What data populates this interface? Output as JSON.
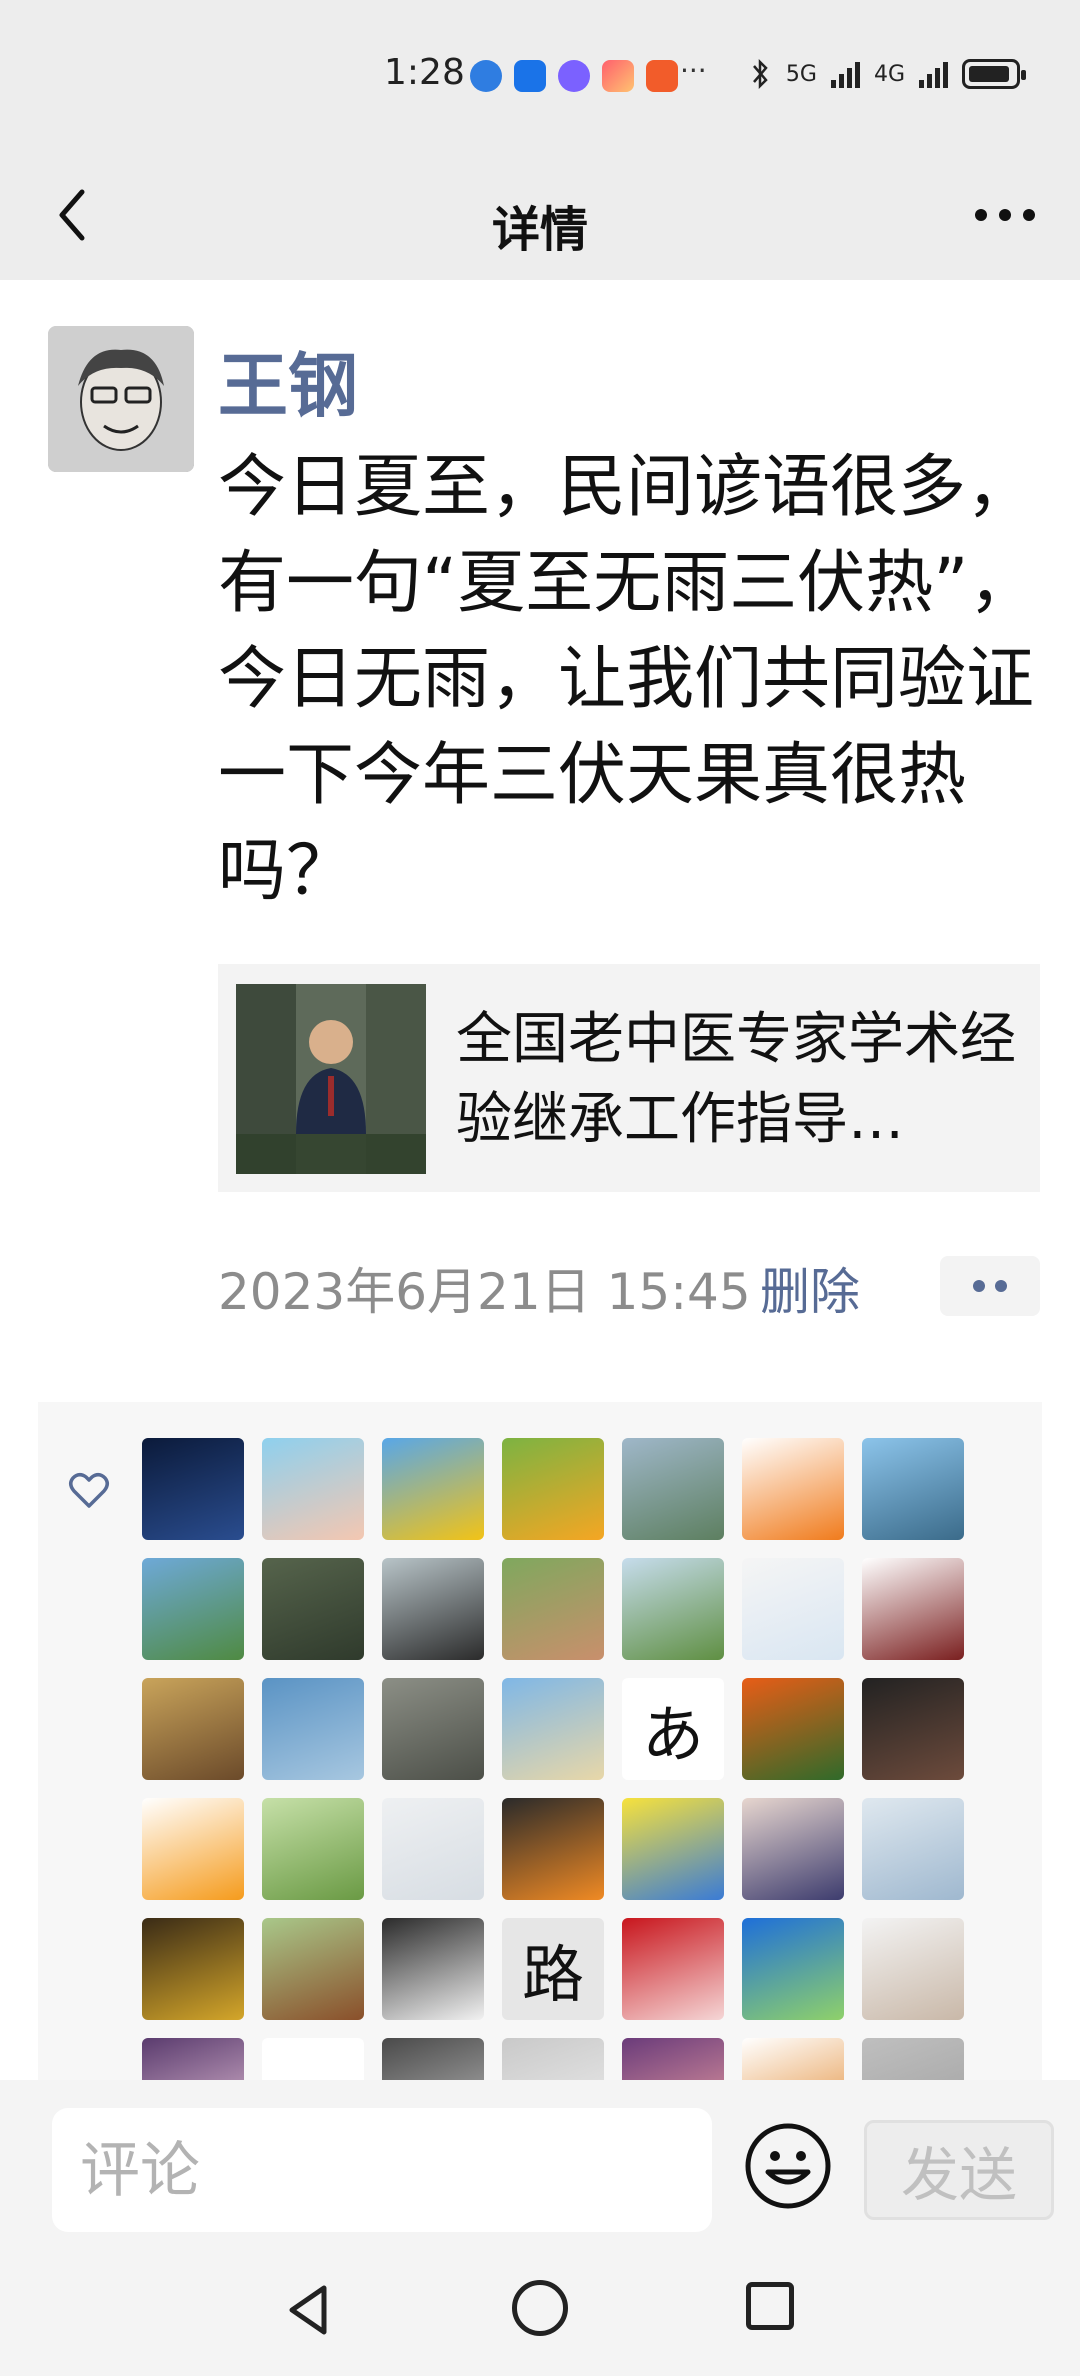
{
  "status_bar": {
    "time": "1:28",
    "network_labels": [
      "5G",
      "4G"
    ]
  },
  "nav": {
    "title": "详情"
  },
  "post": {
    "author": "王钢",
    "text": "今日夏至，民间谚语很多，有一句“夏至无雨三伏热”，今日无雨，让我们共同验证一下今年三伏天果真很热吗？",
    "link_card": {
      "title": "全国老中医专家学术经验继承工作指导…"
    },
    "timestamp": "2023年6月21日 15:45",
    "delete_label": "删除"
  },
  "likes": {
    "avatars": [
      {
        "icon": "planets-avatar",
        "colors": [
          "#0b1a3a",
          "#2a4d8f"
        ]
      },
      {
        "icon": "cartoon-girl-avatar",
        "colors": [
          "#8ed0ee",
          "#f4c7b1"
        ]
      },
      {
        "icon": "sunflower-avatar",
        "colors": [
          "#58a7e8",
          "#f2c316"
        ]
      },
      {
        "icon": "apricots-avatar",
        "colors": [
          "#7cb342",
          "#f5a623"
        ]
      },
      {
        "icon": "city-lake-avatar",
        "colors": [
          "#9fb7c9",
          "#5d7f60"
        ]
      },
      {
        "icon": "orange-flower-avatar",
        "colors": [
          "#ffffff",
          "#f07b1c"
        ]
      },
      {
        "icon": "seaside-avatar",
        "colors": [
          "#8cc4ea",
          "#3b6b8a"
        ]
      },
      {
        "icon": "lake-mountain-avatar",
        "colors": [
          "#6ea9d8",
          "#4f8a42"
        ]
      },
      {
        "icon": "river-rocks-avatar",
        "colors": [
          "#56644c",
          "#2f3a2c"
        ]
      },
      {
        "icon": "crayon-boy-avatar",
        "colors": [
          "#b8c4c8",
          "#2b2b2b"
        ]
      },
      {
        "icon": "child-photo-avatar",
        "colors": [
          "#7fa85e",
          "#c98f6c"
        ]
      },
      {
        "icon": "park-trees-avatar",
        "colors": [
          "#c6dcec",
          "#5f8f42"
        ]
      },
      {
        "icon": "doctor-avatar",
        "colors": [
          "#f5f5f5",
          "#d9e6f2"
        ]
      },
      {
        "icon": "seal-emblem-avatar",
        "colors": [
          "#ffffff",
          "#7a1f1f"
        ]
      },
      {
        "icon": "painting-avatar",
        "colors": [
          "#c9a45b",
          "#6b4a2a"
        ]
      },
      {
        "icon": "sky-person-avatar",
        "colors": [
          "#5a93c4",
          "#a7c7e0"
        ]
      },
      {
        "icon": "family-photo-avatar",
        "colors": [
          "#8c8f86",
          "#4c4f48"
        ]
      },
      {
        "icon": "beach-avatar",
        "colors": [
          "#7fb7e6",
          "#e8d7a8"
        ]
      },
      {
        "icon": "calligraphy-avatar",
        "colors": [
          "#ffffff",
          "#ffffff"
        ],
        "glyph": "あ"
      },
      {
        "icon": "clivia-flower-avatar",
        "colors": [
          "#e85d17",
          "#2f6a2a"
        ]
      },
      {
        "icon": "man-portrait-avatar",
        "colors": [
          "#222222",
          "#6d4b3c"
        ]
      },
      {
        "icon": "tiger-avatar",
        "colors": [
          "#ffffff",
          "#f59b1c"
        ]
      },
      {
        "icon": "green-portrait-avatar",
        "colors": [
          "#c6e0a8",
          "#6a9a44"
        ]
      },
      {
        "icon": "placeholder-mountain-avatar",
        "colors": [
          "#eef0f2",
          "#d7dde3"
        ]
      },
      {
        "icon": "camera-screen-avatar",
        "colors": [
          "#2a2a2a",
          "#f08a24"
        ]
      },
      {
        "icon": "spongebob-avatar",
        "colors": [
          "#f7e23c",
          "#3a7bd5"
        ]
      },
      {
        "icon": "lady-portrait-avatar",
        "colors": [
          "#e7d6cf",
          "#3d3c6e"
        ]
      },
      {
        "icon": "anime-girl-avatar",
        "colors": [
          "#dfe8ef",
          "#9fb8cf"
        ]
      },
      {
        "icon": "shop-front-avatar",
        "colors": [
          "#3a2b16",
          "#d4a62a"
        ]
      },
      {
        "icon": "cow-field-avatar",
        "colors": [
          "#a9c88a",
          "#8a4f2a"
        ]
      },
      {
        "icon": "bride-avatar",
        "colors": [
          "#2b2b2b",
          "#f2f2f2"
        ]
      },
      {
        "icon": "calligraphy-road-avatar",
        "colors": [
          "#e6e6e6",
          "#e6e6e6"
        ],
        "glyph": "路"
      },
      {
        "icon": "lanterns-avatar",
        "colors": [
          "#c8161d",
          "#f5d6d6"
        ]
      },
      {
        "icon": "blue-sky-avatar",
        "colors": [
          "#1e6fd9",
          "#8fd16a"
        ]
      },
      {
        "icon": "girl-hat-avatar",
        "colors": [
          "#f3f3f3",
          "#c9b8a8"
        ]
      },
      {
        "icon": "dusk-avatar",
        "colors": [
          "#5a3b6e",
          "#e6c3d8"
        ]
      },
      {
        "icon": "pattern-avatar",
        "colors": [
          "#ffffff",
          "#ffffff"
        ]
      },
      {
        "icon": "dark-photo-avatar",
        "colors": [
          "#4a4a4a",
          "#bdbdbd"
        ]
      },
      {
        "icon": "sketch-avatar",
        "colors": [
          "#c9c9c9",
          "#eeeeee"
        ]
      },
      {
        "icon": "sunset-avatar",
        "colors": [
          "#6a3b7a",
          "#f0a3a3"
        ]
      },
      {
        "icon": "monkey-avatar",
        "colors": [
          "#ffffff",
          "#e0862b"
        ]
      },
      {
        "icon": "gray-avatar",
        "colors": [
          "#bfbfbf",
          "#9f9f9f"
        ]
      }
    ]
  },
  "comment_bar": {
    "placeholder": "评论",
    "send_label": "发送"
  },
  "colors": {
    "link_blue": "#576b95",
    "header_bg": "#ededed",
    "meta_gray": "#8c8c8c"
  }
}
